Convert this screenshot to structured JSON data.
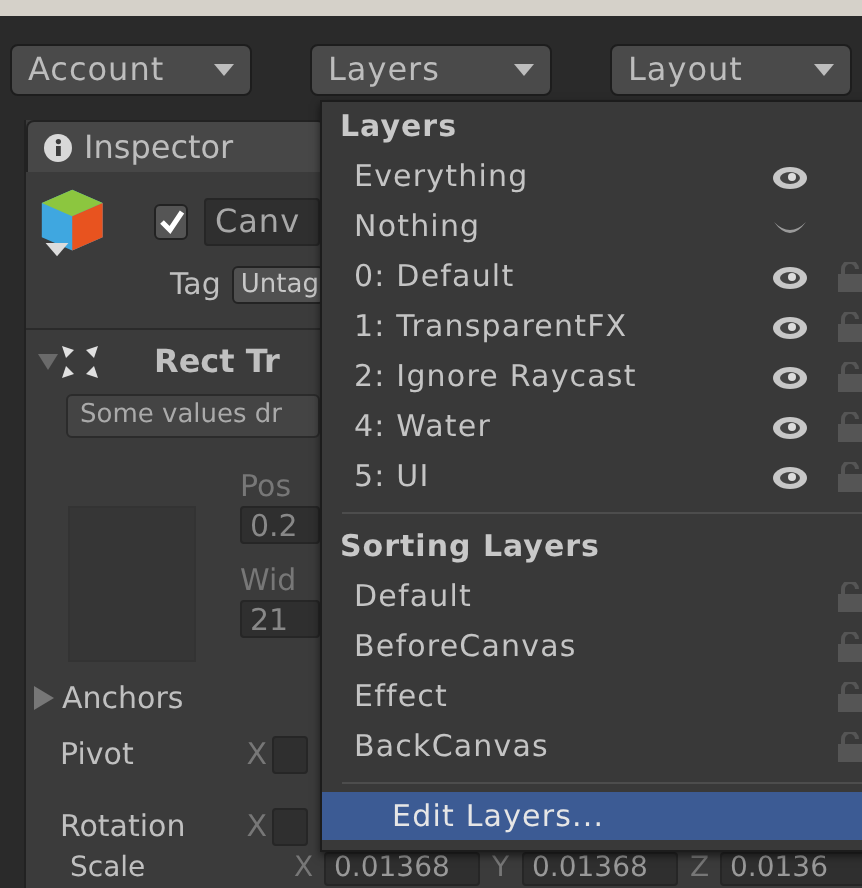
{
  "toolbar": {
    "buttons": [
      {
        "label": "Account"
      },
      {
        "label": "Layers"
      },
      {
        "label": "Layout"
      }
    ]
  },
  "inspector": {
    "tab": "Inspector",
    "object": {
      "active": true,
      "name": "Canv",
      "tag_label": "Tag",
      "tag": "Untag"
    },
    "component": {
      "expanded": true,
      "title": "Rect Tr",
      "notice": "Some values dr",
      "pos_label": "Pos",
      "pos_value": "0.2",
      "width_label": "Wid",
      "width_value": "21"
    },
    "rows": [
      {
        "kind": "foldout",
        "label": "Anchors",
        "expanded": false
      },
      {
        "kind": "vector",
        "label": "Pivot",
        "axes": [
          {
            "axis": "X"
          }
        ]
      },
      {
        "kind": "vector",
        "label": "Rotation",
        "axes": [
          {
            "axis": "X"
          }
        ]
      },
      {
        "kind": "vector",
        "label": "Scale",
        "axes": [
          {
            "axis": "X",
            "value": "0.01368"
          },
          {
            "axis": "Y",
            "value": "0.01368"
          },
          {
            "axis": "Z",
            "value": "0.0136"
          }
        ]
      }
    ]
  },
  "layers_menu": {
    "sections": [
      {
        "title": "Layers",
        "items": [
          {
            "label": "Everything",
            "kind": "mask",
            "visible": true
          },
          {
            "label": "Nothing",
            "kind": "mask",
            "visible": false
          },
          {
            "label": "0: Default",
            "kind": "layer",
            "visible": true
          },
          {
            "label": "1: TransparentFX",
            "kind": "layer",
            "visible": true
          },
          {
            "label": "2: Ignore Raycast",
            "kind": "layer",
            "visible": true
          },
          {
            "label": "4: Water",
            "kind": "layer",
            "visible": true
          },
          {
            "label": "5: UI",
            "kind": "layer",
            "visible": true
          }
        ]
      },
      {
        "title": "Sorting Layers",
        "items": [
          {
            "label": "Default",
            "kind": "sorting"
          },
          {
            "label": "BeforeCanvas",
            "kind": "sorting"
          },
          {
            "label": "Effect",
            "kind": "sorting"
          },
          {
            "label": "BackCanvas",
            "kind": "sorting"
          }
        ]
      }
    ],
    "action": {
      "label": "Edit Layers...",
      "highlighted": true
    }
  }
}
